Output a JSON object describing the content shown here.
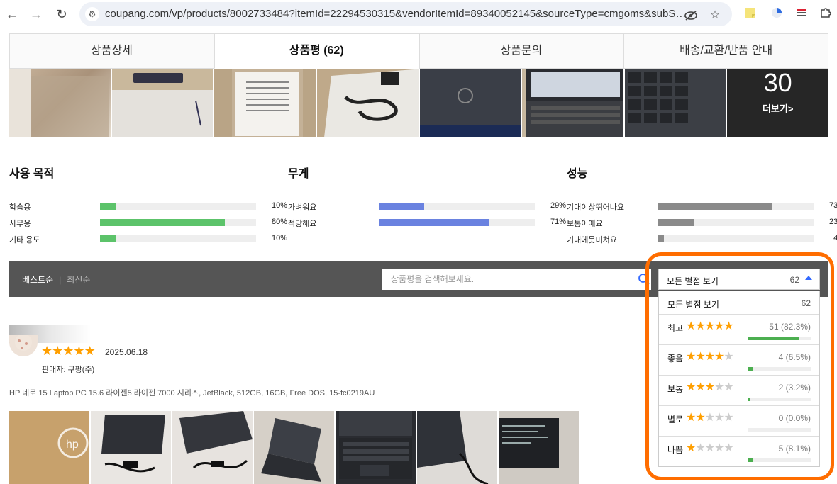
{
  "browser": {
    "url": "coupang.com/vp/products/8002733484?itemId=22294530315&vendorItemId=89340052145&sourceType=cmgoms&subSourc..."
  },
  "tabs": [
    {
      "label": "상품상세"
    },
    {
      "label": "상품평 (62)"
    },
    {
      "label": "상품문의"
    },
    {
      "label": "배송/교환/반품 안내"
    }
  ],
  "photos": {
    "more_count": "30",
    "more_label": "더보기>"
  },
  "surveys": [
    {
      "title": "사용 목적",
      "color": "#5cc36a",
      "rows": [
        {
          "label": "학습용",
          "pct": "10%",
          "value": 10
        },
        {
          "label": "사무용",
          "pct": "80%",
          "value": 80
        },
        {
          "label": "기타 용도",
          "pct": "10%",
          "value": 10
        }
      ]
    },
    {
      "title": "무게",
      "color": "#6a82e0",
      "rows": [
        {
          "label": "가벼워요",
          "pct": "29%",
          "value": 29
        },
        {
          "label": "적당해요",
          "pct": "71%",
          "value": 71
        }
      ]
    },
    {
      "title": "성능",
      "color": "#8a8a8a",
      "rows": [
        {
          "label": "기대이상뛰어나요",
          "pct": "73%",
          "value": 73
        },
        {
          "label": "보통이에요",
          "pct": "23%",
          "value": 23
        },
        {
          "label": "기대에못미쳐요",
          "pct": "4%",
          "value": 4
        }
      ]
    }
  ],
  "filter": {
    "sort_best": "베스트순",
    "sort_sep": "|",
    "sort_latest": "최신순",
    "search_placeholder": "상품평을 검색해보세요."
  },
  "rating_dropdown": {
    "selected": "모든 별점 보기",
    "selected_count": "62",
    "all_label": "모든 별점 보기",
    "all_count": "62",
    "items": [
      {
        "label": "최고",
        "stars": 5,
        "count": "51 (82.3%)",
        "ratio": 0.823
      },
      {
        "label": "좋음",
        "stars": 4,
        "count": "4 (6.5%)",
        "ratio": 0.065
      },
      {
        "label": "보통",
        "stars": 3,
        "count": "2 (3.2%)",
        "ratio": 0.032
      },
      {
        "label": "별로",
        "stars": 2,
        "count": "0 (0.0%)",
        "ratio": 0.0
      },
      {
        "label": "나쁨",
        "stars": 1,
        "count": "5 (8.1%)",
        "ratio": 0.081
      }
    ]
  },
  "review": {
    "stars": 5,
    "date": "2025.06.18",
    "seller": "판매자: 쿠팡(주)",
    "product": "HP 네로 15 Laptop PC 15.6 라이젠5 라이젠 7000 시리즈, JetBlack, 512GB, 16GB, Free DOS, 15-fc0219AU"
  }
}
